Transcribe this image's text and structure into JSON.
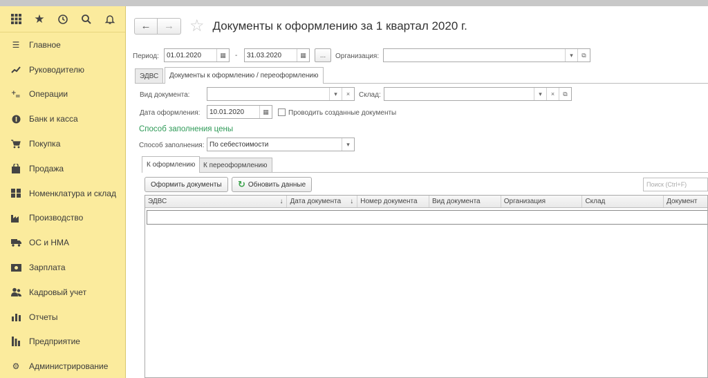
{
  "sidebar": {
    "items": [
      {
        "icon": "menu-lines",
        "label": "Главное"
      },
      {
        "icon": "trend-line",
        "label": "Руководителю"
      },
      {
        "icon": "operations",
        "label": "Операции"
      },
      {
        "icon": "coin",
        "label": "Банк и касса"
      },
      {
        "icon": "cart",
        "label": "Покупка"
      },
      {
        "icon": "bag",
        "label": "Продажа"
      },
      {
        "icon": "warehouse-grid",
        "label": "Номенклатура и склад"
      },
      {
        "icon": "factory",
        "label": "Производство"
      },
      {
        "icon": "truck",
        "label": "ОС и НМА"
      },
      {
        "icon": "cash",
        "label": "Зарплата"
      },
      {
        "icon": "people",
        "label": "Кадровый учет"
      },
      {
        "icon": "bar-chart",
        "label": "Отчеты"
      },
      {
        "icon": "building",
        "label": "Предприятие"
      },
      {
        "icon": "gear",
        "label": "Администрирование"
      }
    ]
  },
  "header": {
    "title": "Документы к оформлению  за 1 квартал 2020 г."
  },
  "filters": {
    "period_label": "Период:",
    "period_from": "01.01.2020",
    "period_dash": "-",
    "period_to": "31.03.2020",
    "more_label": "...",
    "org_label": "Организация:",
    "org_value": ""
  },
  "tabs": [
    {
      "label": "ЭДВС"
    },
    {
      "label": "Документы к оформлению / переоформлению"
    }
  ],
  "form": {
    "doc_type_label": "Вид документа:",
    "doc_type_value": "",
    "warehouse_label": "Склад:",
    "warehouse_value": "",
    "date_label": "Дата оформления:",
    "date_value": "10.01.2020",
    "post_docs_label": "Проводить созданные документы",
    "price_section": "Способ заполнения цены",
    "fill_method_label": "Способ заполнения:",
    "fill_method_value": "По себестоимости"
  },
  "subtabs": [
    {
      "label": "К оформлению"
    },
    {
      "label": "К переоформлению"
    }
  ],
  "actions": {
    "create_docs": "Оформить документы",
    "refresh": "Обновить данные",
    "search_placeholder": "Поиск (Ctrl+F)"
  },
  "table": {
    "columns": [
      "ЭДВС",
      "Дата документа",
      "Номер документа",
      "Вид документа",
      "Организация",
      "Склад",
      "Документ"
    ]
  }
}
